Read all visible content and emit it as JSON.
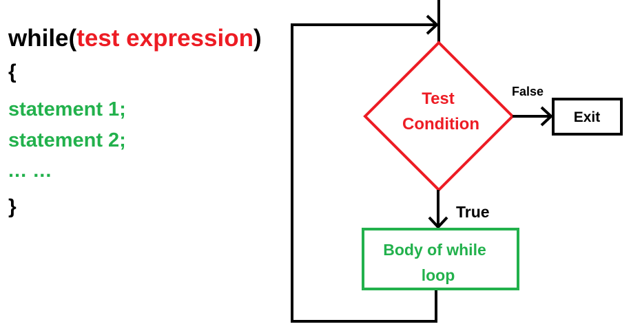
{
  "code": {
    "keyword": "while",
    "open_paren": "(",
    "test_expression": "test expression",
    "close_paren": ")",
    "open_brace": "{",
    "statement_1": "statement 1;",
    "statement_2": "statement 2;",
    "ellipsis": "... ...",
    "close_brace": "}"
  },
  "flowchart": {
    "condition_line1": "Test",
    "condition_line2": "Condition",
    "false_label": "False",
    "true_label": "True",
    "exit_label": "Exit",
    "body_line1": "Body of while",
    "body_line2": "loop"
  },
  "colors": {
    "black": "#000000",
    "red": "#ed1c24",
    "green": "#22b14c"
  }
}
